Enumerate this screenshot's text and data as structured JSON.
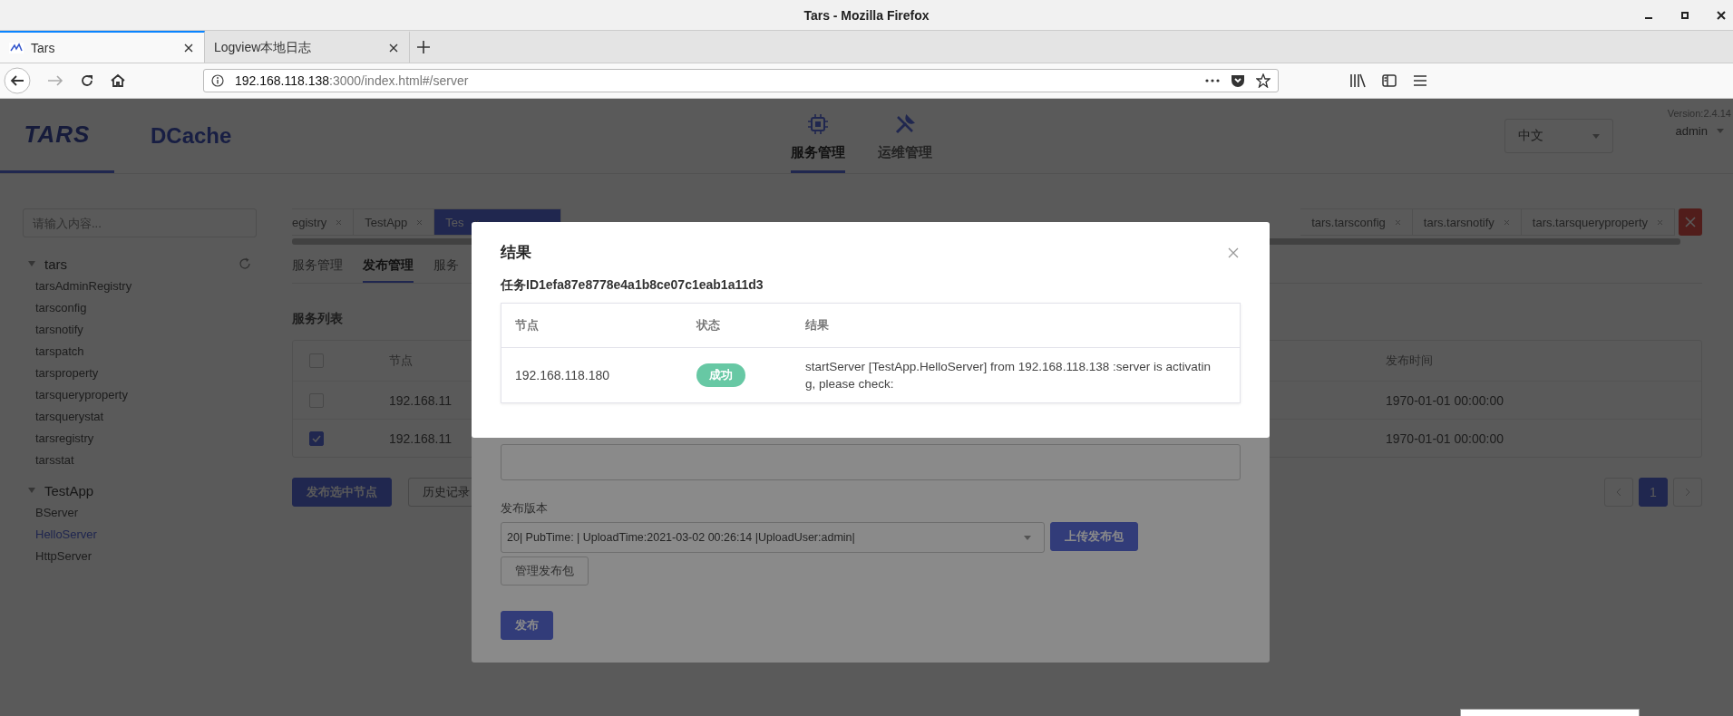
{
  "browser": {
    "window_title": "Tars - Mozilla Firefox",
    "tabs": [
      {
        "title": "Tars",
        "selected": true
      },
      {
        "title": "Logview本地日志",
        "selected": false
      }
    ],
    "url_host": "192.168.118.138",
    "url_rest": ":3000/index.html#/server"
  },
  "header": {
    "logo": "TARS",
    "second_logo": "DCache",
    "nav": [
      {
        "label": "服务管理",
        "kind": "chip",
        "selected": true
      },
      {
        "label": "运维管理",
        "kind": "tools",
        "selected": false
      }
    ],
    "language": "中文",
    "version": "Version:2.4.14",
    "user": "admin"
  },
  "sidebar": {
    "placeholder": "请输入内容...",
    "tree": [
      {
        "label": "tars",
        "expanded": true,
        "children": [
          {
            "label": "tarsAdminRegistry",
            "selected": false
          },
          {
            "label": "tarsconfig",
            "selected": false
          },
          {
            "label": "tarsnotify",
            "selected": false
          },
          {
            "label": "tarspatch",
            "selected": false
          },
          {
            "label": "tarsproperty",
            "selected": false
          },
          {
            "label": "tarsqueryproperty",
            "selected": false
          },
          {
            "label": "tarsquerystat",
            "selected": false
          },
          {
            "label": "tarsregistry",
            "selected": false
          },
          {
            "label": "tarsstat",
            "selected": false
          }
        ]
      },
      {
        "label": "TestApp",
        "expanded": true,
        "children": [
          {
            "label": "BServer",
            "selected": false
          },
          {
            "label": "HelloServer",
            "selected": true
          },
          {
            "label": "HttpServer",
            "selected": false
          }
        ]
      }
    ]
  },
  "tabs_left": [
    {
      "label": "egistry",
      "selected": false
    },
    {
      "label": "TestApp",
      "selected": false
    },
    {
      "label": "Tes",
      "selected": true
    }
  ],
  "tabs_right": [
    {
      "label": "tars.tarsconfig",
      "selected": false
    },
    {
      "label": "tars.tarsnotify",
      "selected": false
    },
    {
      "label": "tars.tarsqueryproperty",
      "selected": false
    }
  ],
  "sub_tabs": [
    {
      "label": "服务管理",
      "selected": false
    },
    {
      "label": "发布管理",
      "selected": true
    },
    {
      "label": "服务",
      "selected": false
    }
  ],
  "section_title": "服务列表",
  "table": {
    "header_checked": false,
    "columns": [
      "节点",
      "发布时间"
    ],
    "rows": [
      {
        "checked": false,
        "node": "192.168.11",
        "time": "1970-01-01 00:00:00"
      },
      {
        "checked": true,
        "node": "192.168.11",
        "time": "1970-01-01 00:00:00"
      }
    ]
  },
  "actions": [
    "发布选中节点",
    "历史记录"
  ],
  "pages": [
    {
      "label": "1",
      "selected": true
    }
  ],
  "publish_dialog": {
    "version_label": "发布版本",
    "version_value": "20| PubTime: | UploadTime:2021-03-02 00:26:14 |UploadUser:admin|",
    "upload_button": "上传发布包",
    "manage_button": "管理发布包",
    "publish_button": "发布"
  },
  "result_modal": {
    "title": "结果",
    "task": "任务ID1efa87e8778e4a1b8ce07c1eab1a11d3",
    "columns": [
      "节点",
      "状态",
      "结果"
    ],
    "rows": [
      {
        "node": "192.168.118.180",
        "status": "成功",
        "result": "startServer [TestApp.HelloServer] from 192.168.118.138 :server is activating, please check:"
      }
    ]
  }
}
